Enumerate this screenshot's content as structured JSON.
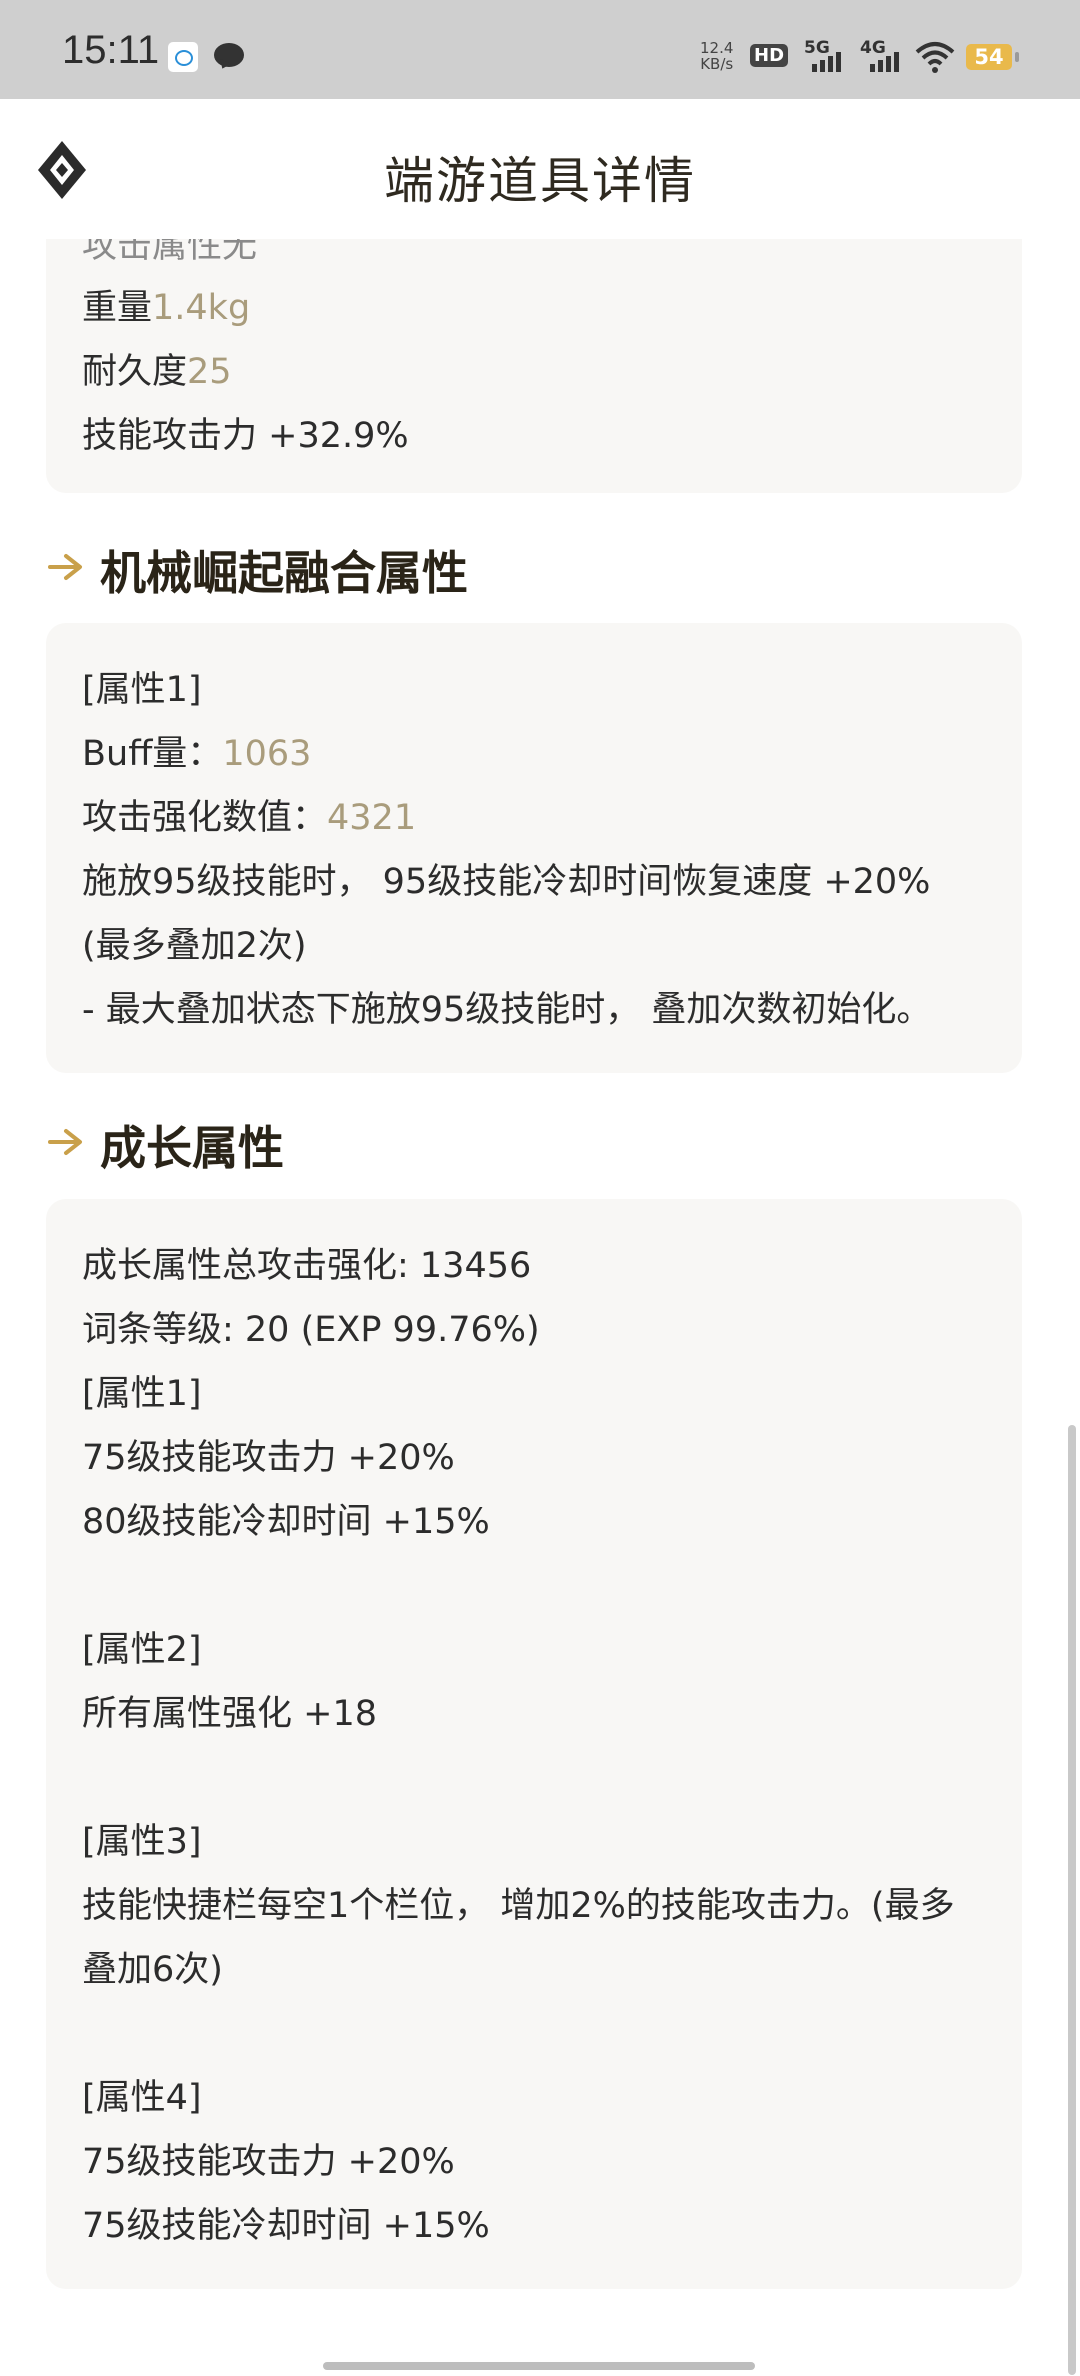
{
  "status_bar": {
    "time": "15:11",
    "speed_value": "12.4",
    "speed_unit": "KB/s",
    "hd": "HD",
    "sim1": "5G",
    "sim2": "4G",
    "battery": "54"
  },
  "header": {
    "title": "端游道具详情",
    "logo_icon": "diamond-logo-icon"
  },
  "basic_attributes": {
    "cut_line": "攻击属性无",
    "weight_label": "重量",
    "weight_value": "1.4kg",
    "durability_label": "耐久度",
    "durability_value": "25",
    "skill_attack": "技能攻击力 +32.9%"
  },
  "fusion_section": {
    "title": "机械崛起融合属性",
    "lines": {
      "attr1": "[属性1]",
      "buff_label": "Buff量：",
      "buff_value": "1063",
      "atk_label": "攻击强化数值：",
      "atk_value": "4321",
      "effect": "施放95级技能时，  95级技能冷却时间恢复速度 +20%",
      "stack": "(最多叠加2次)",
      "reset": "- 最大叠加状态下施放95级技能时，  叠加次数初始化。"
    }
  },
  "growth_section": {
    "title": "成长属性",
    "lines": [
      "成长属性总攻击强化: 13456",
      "词条等级: 20 (EXP 99.76%)",
      "[属性1]",
      "75级技能攻击力 +20%",
      "80级技能冷却时间 +15%",
      "[属性2]",
      "所有属性强化 +18",
      "[属性3]",
      "技能快捷栏每空1个栏位，  增加2%的技能攻击力。(最多",
      "叠加6次)",
      "[属性4]",
      "75级技能攻击力 +20%",
      "75级技能冷却时间 +15%"
    ]
  },
  "colors": {
    "accent": "#c9a04a",
    "value_text": "#a99c7c",
    "card_bg": "#f8f7f5",
    "status_bg": "#cfcfcf"
  }
}
